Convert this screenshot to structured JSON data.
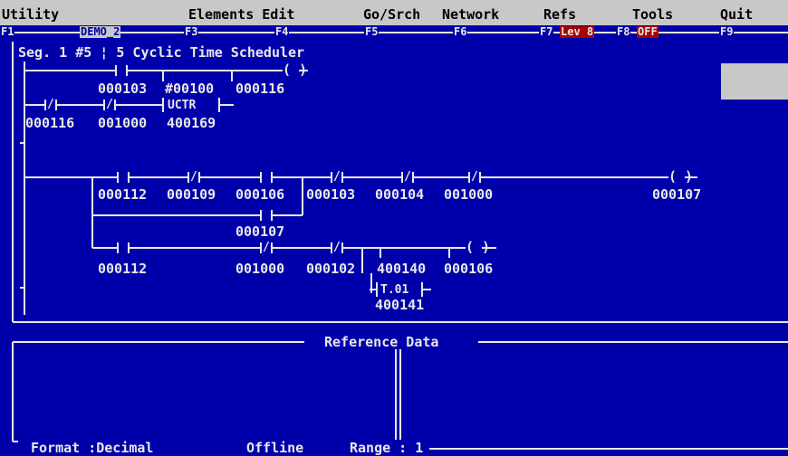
{
  "menu": [
    "Utility",
    "Elements Edit",
    "Go/Srch",
    "Network",
    "Refs",
    "Tools",
    "Quit"
  ],
  "fkeys": {
    "f1": "F1",
    "demo": "DEMO_2",
    "f3": "F3",
    "f4": "F4",
    "f5": "F5",
    "f6": "F6",
    "f7": "F7",
    "lev": "Lev 8",
    "f8": "F8",
    "off": "OFF",
    "f9": "F9"
  },
  "ladder": {
    "segment_title": "Seg. 1 #5 ¦ 5 Cyclic Time Scheduler",
    "rung1": {
      "a": "000103",
      "b": "#00100",
      "c": "000116"
    },
    "rung2": {
      "a": "000116",
      "b": "001000",
      "c": "400169",
      "block": "UCTR"
    },
    "rung3": {
      "a": "000112",
      "b": "000109",
      "c": "000106",
      "d": "000103",
      "e": "000104",
      "f": "001000",
      "coil": "000107"
    },
    "branch1": {
      "a": "000107"
    },
    "branch2": {
      "a": "000112",
      "b": "001000",
      "c": "000102",
      "d": "400140",
      "e": "000106",
      "block": "T.01",
      "f": "400141"
    },
    "symbols": {
      "coil": "( )",
      "nc": "/"
    }
  },
  "reference": {
    "title": "Reference Data",
    "format": "Format :Decimal",
    "status": "Offline",
    "range": "Range : 1"
  },
  "colors": {
    "background": "#0000aa",
    "menubar": "#c8c8c8",
    "highlight": "#aa0000",
    "text": "#e8e8e8"
  }
}
